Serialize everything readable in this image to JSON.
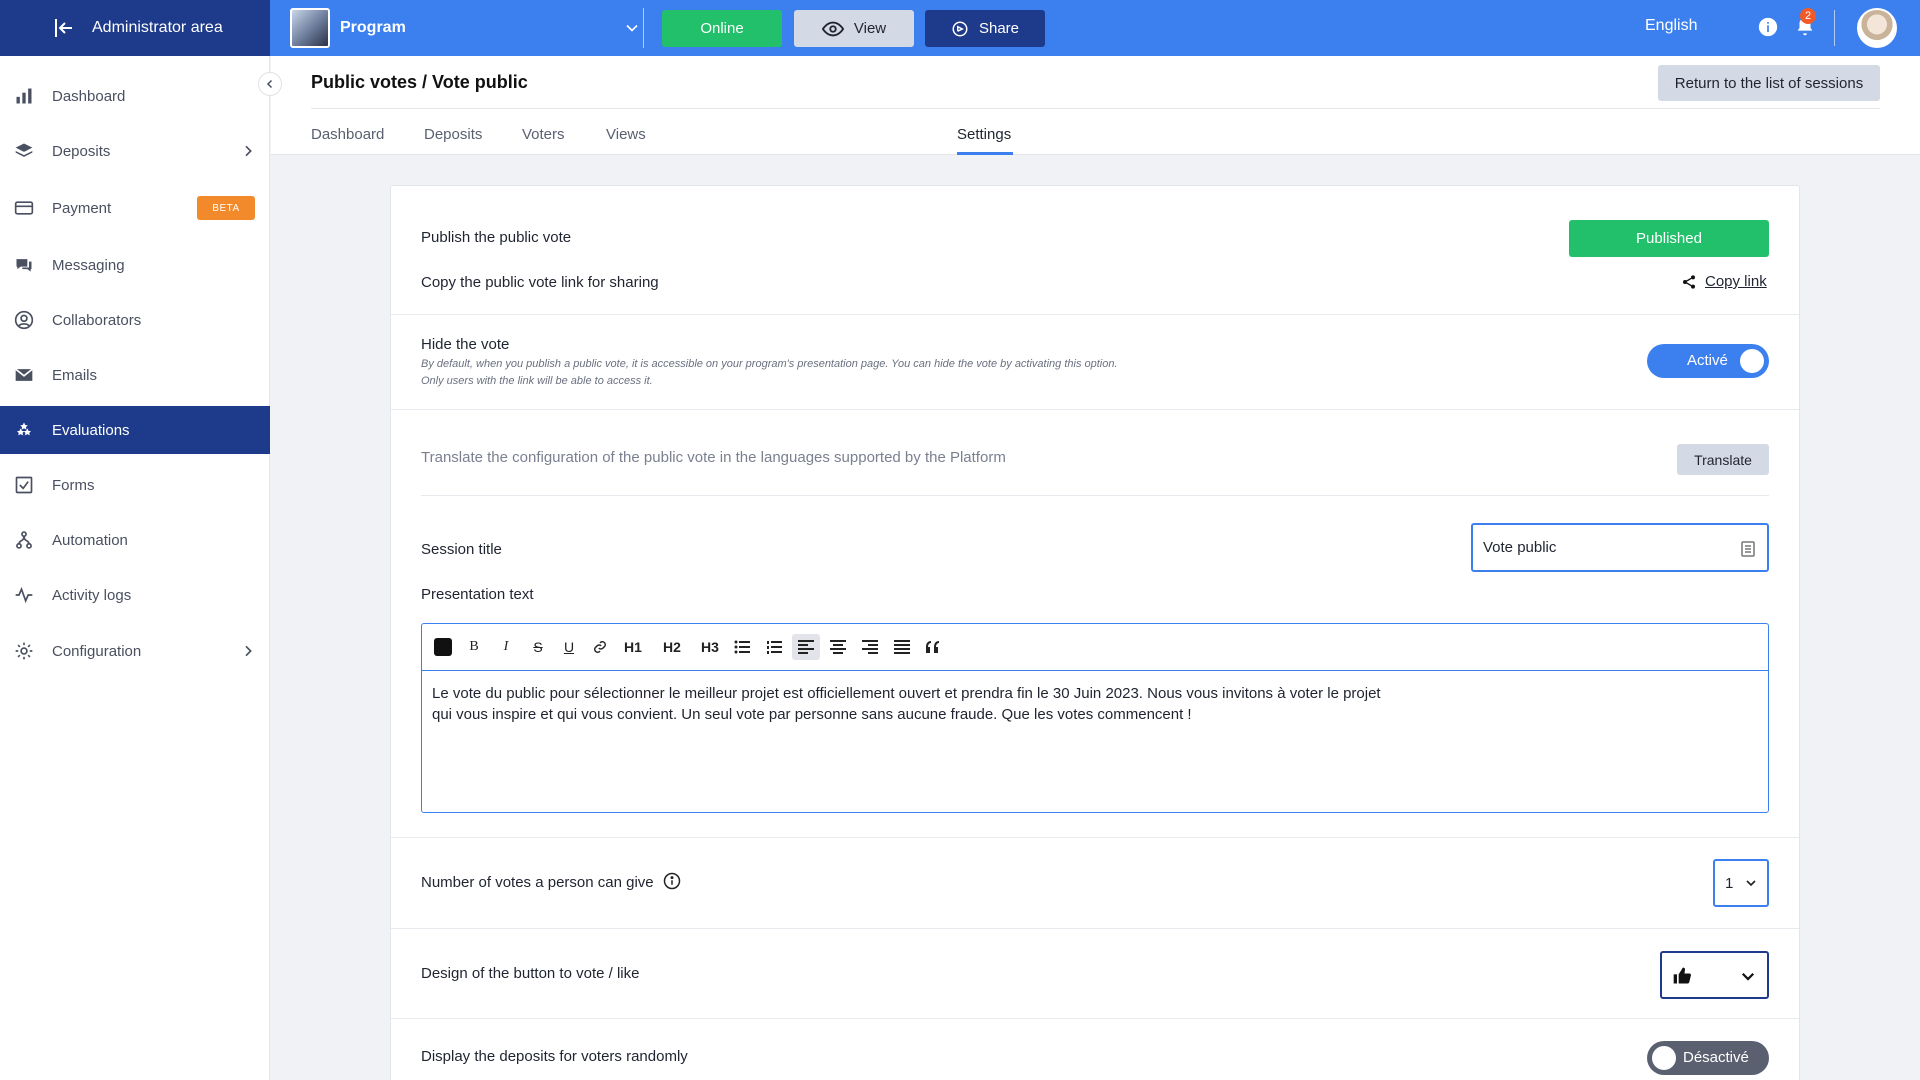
{
  "topbar": {
    "admin_area": "Administrator area",
    "program_name": "Program",
    "online_label": "Online",
    "view_label": "View",
    "share_label": "Share",
    "language": "English",
    "notifications_count": "2"
  },
  "sidebar": {
    "items": [
      {
        "label": "Dashboard",
        "icon": "bar-chart-icon"
      },
      {
        "label": "Deposits",
        "icon": "layers-icon"
      },
      {
        "label": "Payment",
        "icon": "credit-card-icon",
        "badge": "BETA"
      },
      {
        "label": "Messaging",
        "icon": "chat-icon"
      },
      {
        "label": "Collaborators",
        "icon": "user-circle-icon"
      },
      {
        "label": "Emails",
        "icon": "envelope-icon"
      },
      {
        "label": "Evaluations",
        "icon": "stars-icon"
      },
      {
        "label": "Forms",
        "icon": "checkbox-icon"
      },
      {
        "label": "Automation",
        "icon": "flow-icon"
      },
      {
        "label": "Activity logs",
        "icon": "pulse-icon"
      },
      {
        "label": "Configuration",
        "icon": "gear-icon"
      }
    ]
  },
  "page": {
    "title": "Public votes / Vote public",
    "return_label": "Return to the list of sessions",
    "tabs": [
      "Dashboard",
      "Deposits",
      "Voters",
      "Views",
      "Settings"
    ]
  },
  "settings": {
    "publish_label": "Publish the public vote",
    "published_button": "Published",
    "copy_link_desc": "Copy the public vote link for sharing",
    "copy_link_label": "Copy link",
    "hide_vote_label": "Hide the vote",
    "hide_vote_desc": "By default, when you publish a public vote, it is accessible on your program's presentation page. You can hide the vote by activating this option. Only users with the link will be able to access it.",
    "hide_vote_toggle": "Activé",
    "translate_desc": "Translate the configuration of the public vote in the languages supported by the Platform",
    "translate_button": "Translate",
    "session_title_label": "Session title",
    "session_title_value": "Vote public",
    "presentation_label": "Presentation text",
    "presentation_text_line1": "Le vote du public pour sélectionner le meilleur projet est officiellement ouvert et prendra fin le 30 Juin 2023. Nous vous invitons à voter le projet",
    "presentation_text_line2": "qui vous inspire et qui vous convient. Un seul vote par personne sans aucune fraude. Que les votes commencent !",
    "toolbar": {
      "b": "B",
      "i": "I",
      "s": "S",
      "u": "U",
      "h1": "H1",
      "h2": "H2",
      "h3": "H3"
    },
    "votes_label": "Number of votes a person can give",
    "votes_value": "1",
    "design_label": "Design of the button to vote / like",
    "random_label": "Display the deposits for voters randomly",
    "random_toggle": "Désactivé"
  },
  "colors": {
    "topbar": "#3c80ef",
    "navy": "#1e3a8a",
    "green": "#22c06a",
    "beta": "#f2892a"
  }
}
